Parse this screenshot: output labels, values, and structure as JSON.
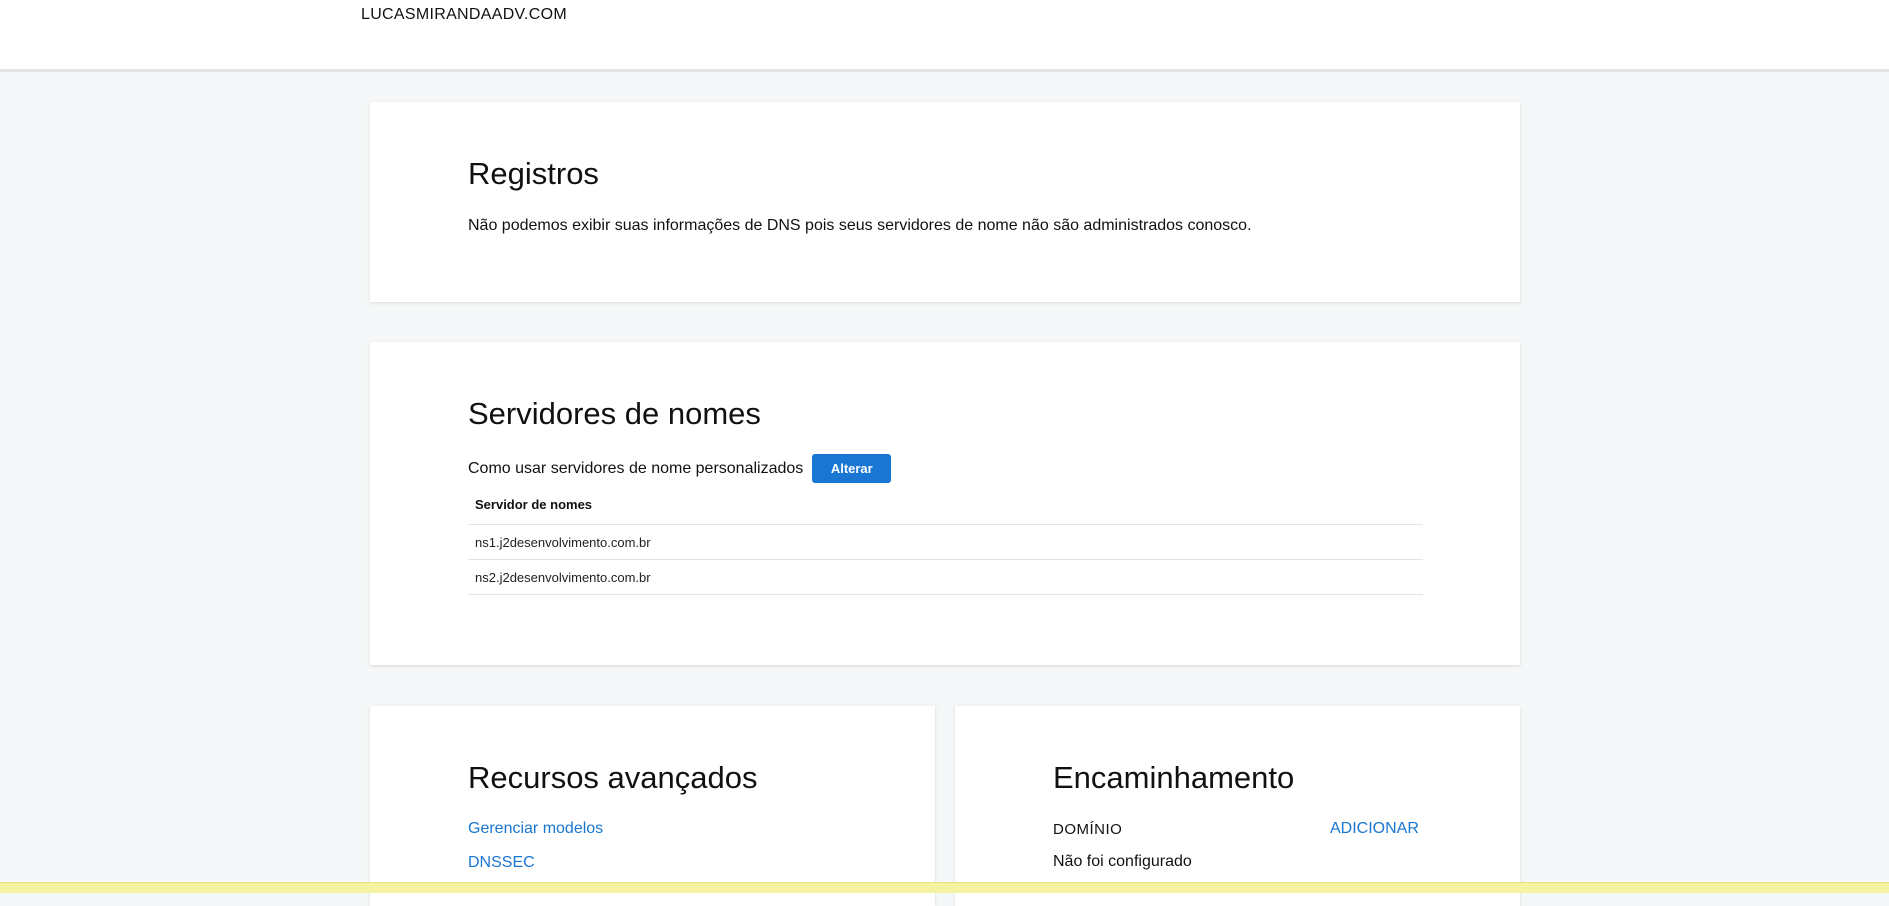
{
  "header": {
    "domain": "LUCASMIRANDAADV.COM"
  },
  "registros": {
    "title": "Registros",
    "message": "Não podemos exibir suas informações de DNS pois seus servidores de nome não são administrados conosco."
  },
  "nameservers": {
    "title": "Servidores de nomes",
    "custom_label": "Como usar servidores de nome personalizados",
    "change_button": "Alterar",
    "column_header": "Servidor de nomes",
    "rows": [
      "ns1.j2desenvolvimento.com.br",
      "ns2.j2desenvolvimento.com.br"
    ]
  },
  "advanced": {
    "title": "Recursos avançados",
    "links": [
      "Gerenciar modelos",
      "DNSSEC"
    ]
  },
  "forwarding": {
    "title": "Encaminhamento",
    "domain_label": "DOMÍNIO",
    "add_label": "ADICIONAR",
    "status": "Não foi configurado"
  },
  "colors": {
    "accent": "#1976d2",
    "background": "#f5f7f8"
  }
}
